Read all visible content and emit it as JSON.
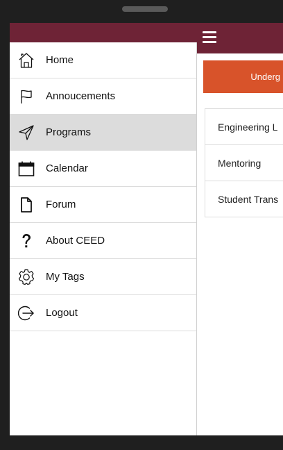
{
  "drawer": {
    "items": [
      {
        "label": "Home",
        "icon": "home-icon",
        "active": false
      },
      {
        "label": "Annoucements",
        "icon": "flag-icon",
        "active": false
      },
      {
        "label": "Programs",
        "icon": "send-icon",
        "active": true
      },
      {
        "label": "Calendar",
        "icon": "calendar-icon",
        "active": false
      },
      {
        "label": "Forum",
        "icon": "document-icon",
        "active": false
      },
      {
        "label": "About CEED",
        "icon": "question-icon",
        "active": false
      },
      {
        "label": "My Tags",
        "icon": "gear-icon",
        "active": false
      },
      {
        "label": "Logout",
        "icon": "logout-icon",
        "active": false
      }
    ]
  },
  "main": {
    "tab_label": "Underg",
    "programs": [
      "Engineering L",
      "Mentoring",
      "Student Trans"
    ]
  },
  "colors": {
    "header": "#6e2336",
    "tab": "#d8532a",
    "active_item": "#dcdcdc"
  }
}
